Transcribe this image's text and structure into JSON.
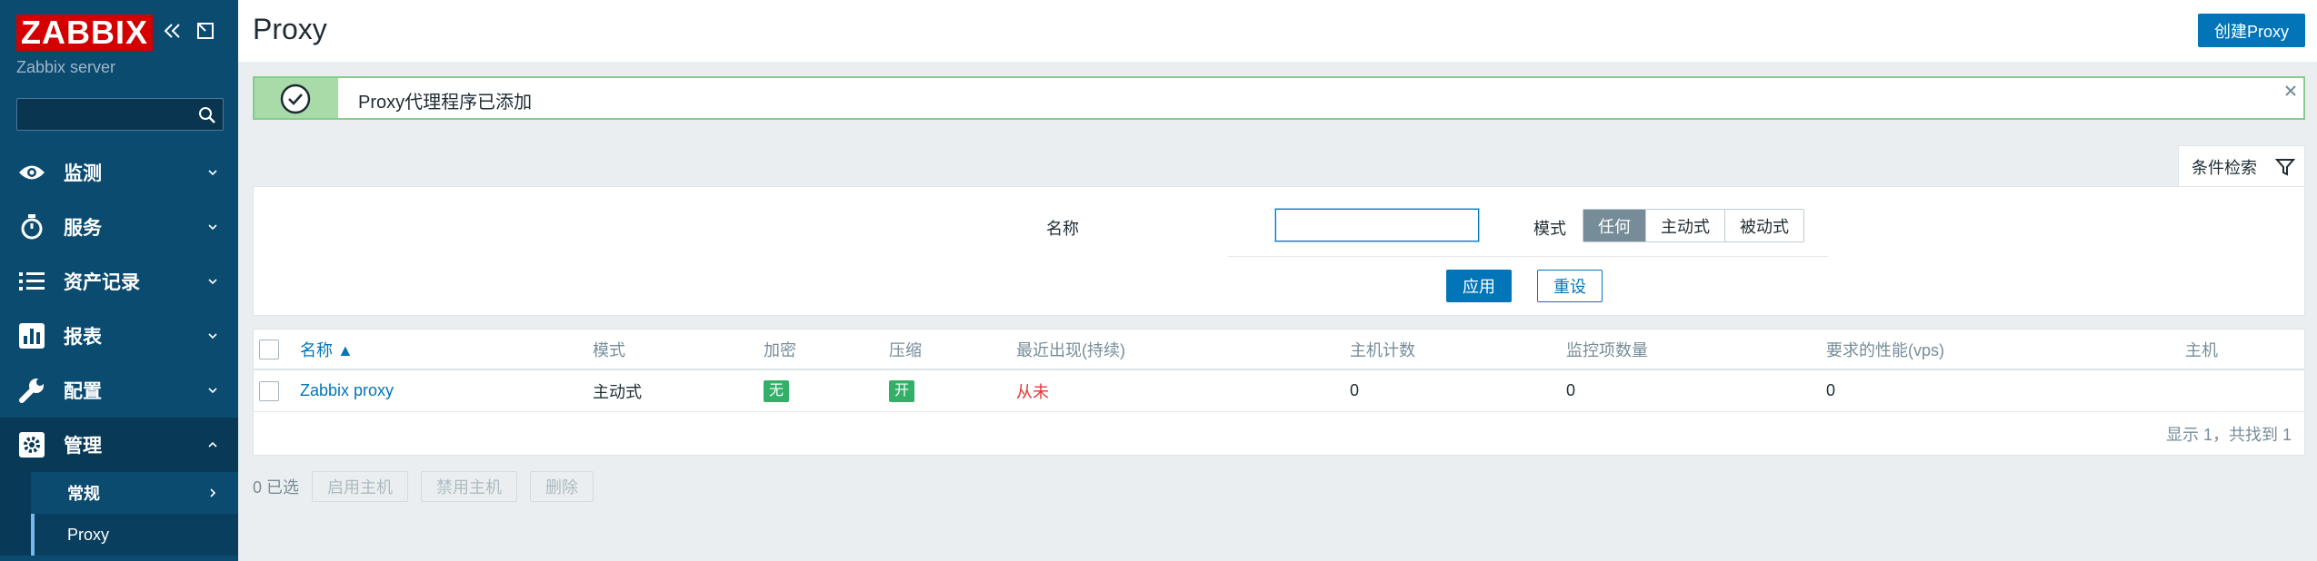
{
  "sidebar": {
    "logo": "ZABBIX",
    "server_name": "Zabbix server",
    "search_placeholder": "",
    "items": [
      {
        "label": "监测",
        "icon": "eye-icon"
      },
      {
        "label": "服务",
        "icon": "stopwatch-icon"
      },
      {
        "label": "资产记录",
        "icon": "list-icon"
      },
      {
        "label": "报表",
        "icon": "bar-chart-icon"
      },
      {
        "label": "配置",
        "icon": "wrench-icon"
      },
      {
        "label": "管理",
        "icon": "gear-icon"
      }
    ],
    "subitems": [
      {
        "label": "常规"
      },
      {
        "label": "Proxy"
      }
    ]
  },
  "header": {
    "title": "Proxy",
    "create_label": "创建Proxy"
  },
  "message": {
    "text": "Proxy代理程序已添加"
  },
  "filter": {
    "tab_label": "条件检索",
    "name_label": "名称",
    "name_value": "",
    "mode_label": "模式",
    "mode_options": [
      "任何",
      "主动式",
      "被动式"
    ],
    "mode_selected": "任何",
    "apply_label": "应用",
    "reset_label": "重设"
  },
  "table": {
    "columns": [
      "名称 ▲",
      "模式",
      "加密",
      "压缩",
      "最近出现(持续)",
      "主机计数",
      "监控项数量",
      "要求的性能(vps)",
      "主机"
    ],
    "rows": [
      {
        "name": "Zabbix proxy",
        "mode": "主动式",
        "encryption": "无",
        "compression": "开",
        "last_seen": "从未",
        "host_count": "0",
        "item_count": "0",
        "vps": "0",
        "hosts": ""
      }
    ],
    "footer": "显示 1，共找到 1"
  },
  "actions": {
    "selected": "0 已选",
    "enable_label": "启用主机",
    "disable_label": "禁用主机",
    "delete_label": "删除"
  },
  "colors": {
    "sidebar_bg": "#0b4b70",
    "accent": "#0275b8",
    "logo_red": "#d40000",
    "success_green": "#34af67",
    "error_red": "#e33734"
  }
}
